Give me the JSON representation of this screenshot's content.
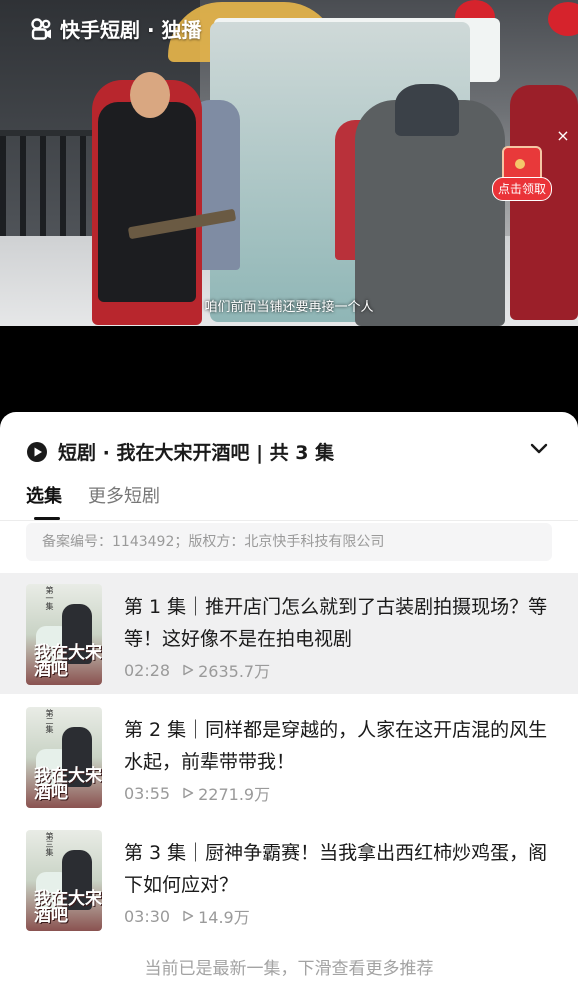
{
  "app": {
    "logo_text": "快手短剧 · 独播"
  },
  "player": {
    "subtitle": "咱们前面当铺还要再接一个人",
    "close_glyph": "×",
    "claim_label": "点击领取"
  },
  "sheet": {
    "series_title": "短剧 · 我在大宋开酒吧 | 共 3 集",
    "tabs": [
      {
        "label": "选集",
        "active": true
      },
      {
        "label": "更多短剧",
        "active": false
      }
    ],
    "notice": "备案编号：1143492；版权方：北京快手科技有限公司",
    "episodes": [
      {
        "title": "第 1 集｜推开店门怎么就到了古装剧拍摄现场？等等！这好像不是在拍电视剧",
        "duration": "02:28",
        "views": "2635.7万",
        "thumb_badge": "第一集",
        "current": true
      },
      {
        "title": "第 2 集｜同样都是穿越的，人家在这开店混的风生水起，前辈带带我！",
        "duration": "03:55",
        "views": "2271.9万",
        "thumb_badge": "第二集",
        "current": false
      },
      {
        "title": "第 3 集｜厨神争霸赛！当我拿出西红柿炒鸡蛋，阁下如何应对？",
        "duration": "03:30",
        "views": "14.9万",
        "thumb_badge": "第三集",
        "current": false
      }
    ],
    "thumb_title": "我在大宋酒吧",
    "footer_tip": "当前已是最新一集，下滑查看更多推荐"
  },
  "colors": {
    "accent_red": "#ea3338",
    "current_row_bg": "#f0f0f1"
  }
}
